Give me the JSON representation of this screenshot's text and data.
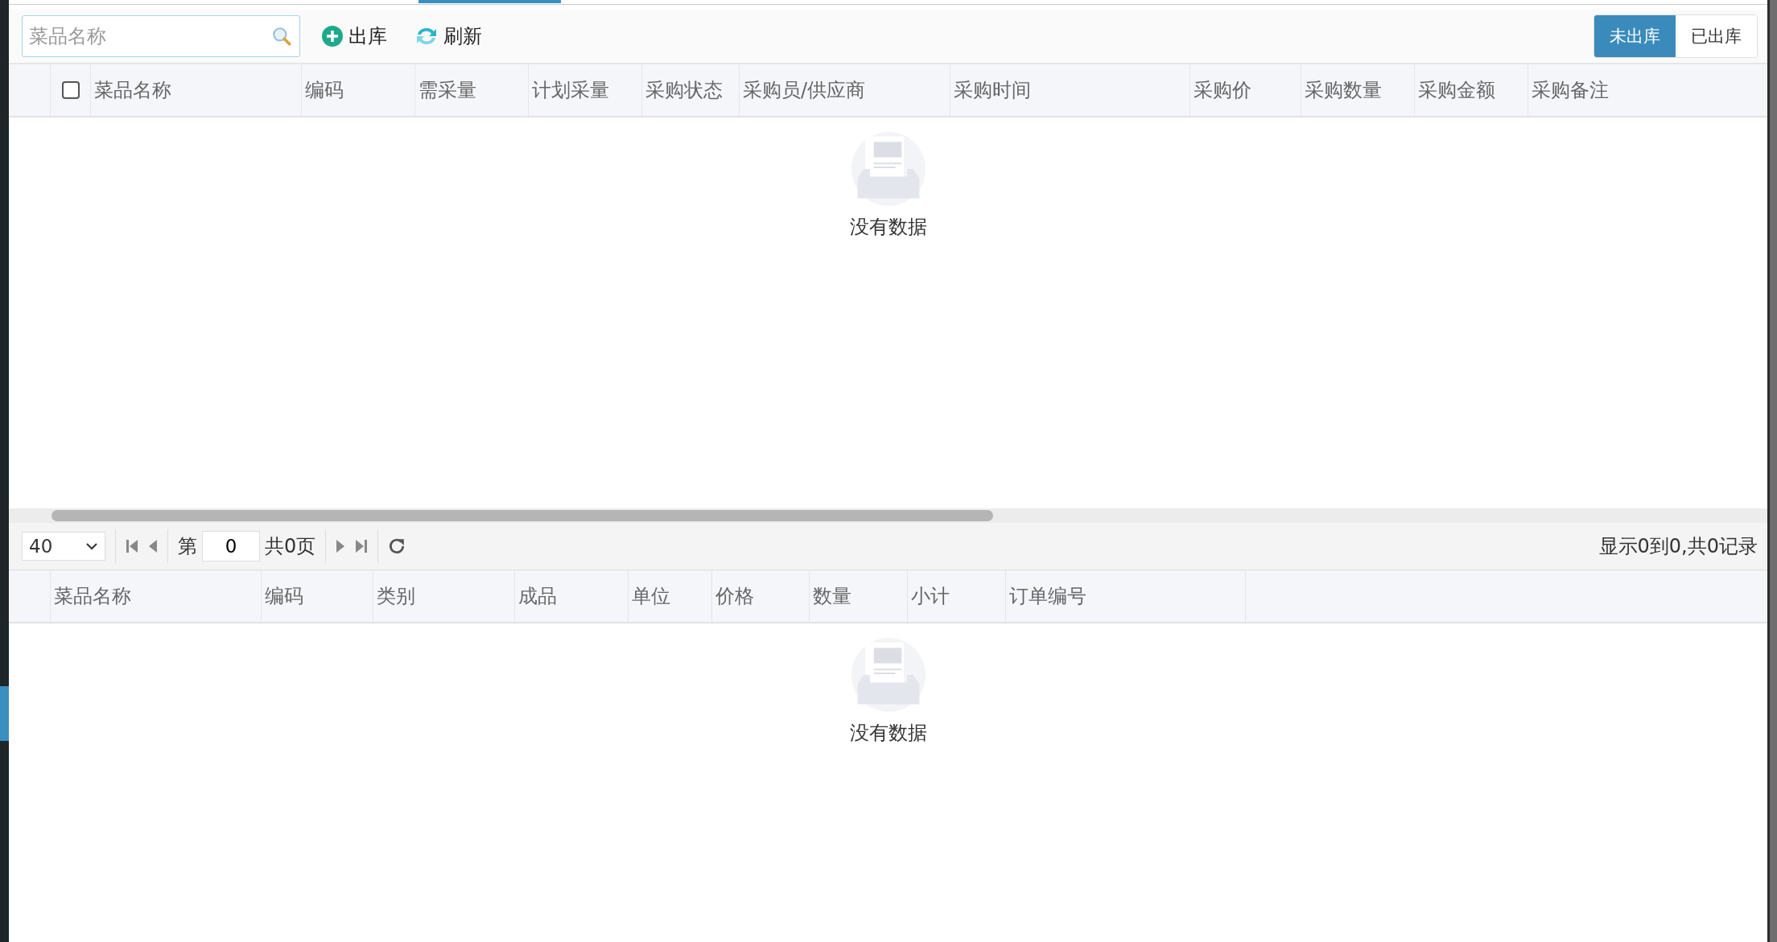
{
  "search": {
    "placeholder": "菜品名称"
  },
  "toolbar": [
    {
      "kind": "add",
      "label": "出库"
    },
    {
      "kind": "refresh",
      "label": "刷新"
    }
  ],
  "status_tabs": [
    {
      "label": "未出库",
      "selected": true
    },
    {
      "label": "已出库",
      "selected": false
    }
  ],
  "main_table": {
    "select_all_checked": false,
    "columns": [
      "菜品名称",
      "编码",
      "需采量",
      "计划采量",
      "采购状态",
      "采购员/供应商",
      "采购时间",
      "采购价",
      "采购数量",
      "采购金额",
      "采购备注"
    ],
    "empty_text": "没有数据"
  },
  "pager": {
    "page_size": "40",
    "page_prefix": "第",
    "page": "0",
    "total_pages": "共0页",
    "info": "显示0到0,共0记录"
  },
  "detail_table": {
    "columns": [
      "菜品名称",
      "编码",
      "类别",
      "成品",
      "单位",
      "价格",
      "数量",
      "小计",
      "订单编号"
    ],
    "empty_text": "没有数据"
  }
}
